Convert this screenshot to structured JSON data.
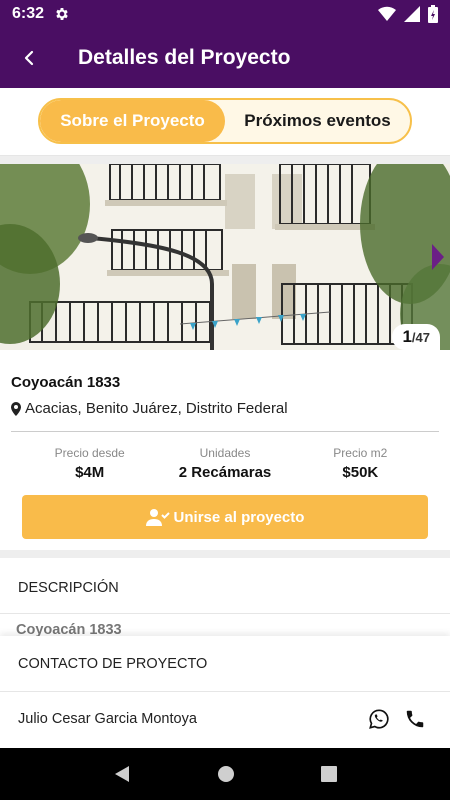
{
  "status_bar": {
    "time": "6:32"
  },
  "app_bar": {
    "title": "Detalles del Proyecto"
  },
  "tabs": [
    {
      "label": "Sobre el Proyecto",
      "active": true
    },
    {
      "label": "Próximos eventos",
      "active": false
    }
  ],
  "gallery": {
    "current": "1",
    "total": "/47"
  },
  "project": {
    "name": "Coyoacán 1833",
    "address": "Acacias, Benito Juárez, Distrito Federal"
  },
  "stats": [
    {
      "label": "Precio desde",
      "value": "$4M"
    },
    {
      "label": "Unidades",
      "value": "2 Recámaras"
    },
    {
      "label": "Precio m2",
      "value": "$50K"
    }
  ],
  "join_button": {
    "label": "Unirse al proyecto"
  },
  "description": {
    "heading": "DESCRIPCIÓN",
    "peek_text": "Coyoacán 1833"
  },
  "contact": {
    "heading": "CONTACTO DE PROYECTO",
    "name": "Julio Cesar Garcia Montoya"
  },
  "colors": {
    "brand": "#4a0e63",
    "accent": "#f9bb4a"
  },
  "icons": [
    "settings-icon",
    "wifi-icon",
    "signal-icon",
    "battery-icon",
    "back-arrow-icon",
    "map-pin-icon",
    "user-check-icon",
    "whatsapp-icon",
    "phone-icon",
    "nav-back-icon",
    "nav-home-icon",
    "nav-recents-icon",
    "chevron-right-icon"
  ]
}
